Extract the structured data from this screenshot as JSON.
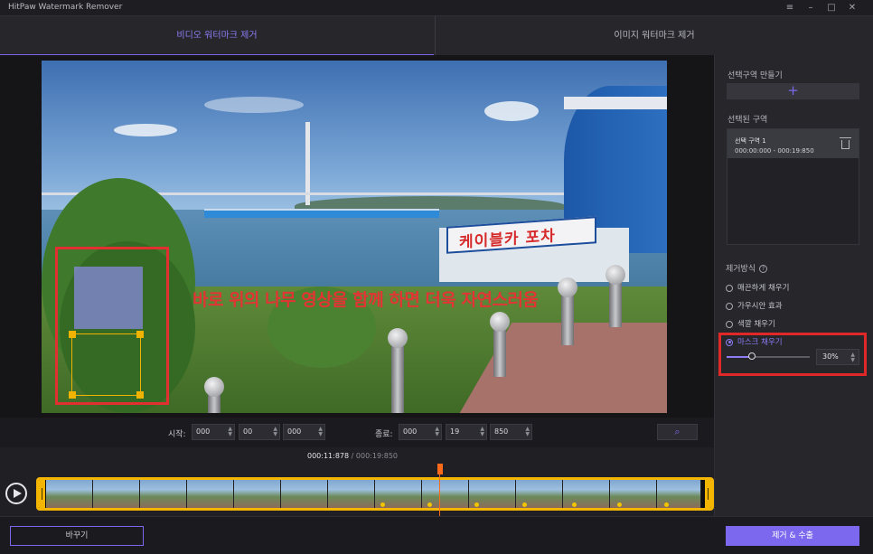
{
  "window": {
    "title": "HitPaw Watermark Remover",
    "controls": [
      "menu-icon",
      "minimize-icon",
      "maximize-icon",
      "close-icon"
    ]
  },
  "tabs": [
    {
      "label": "비디오 워터마크 제거",
      "active": true
    },
    {
      "label": "이미지 워터마크 제거",
      "active": false
    }
  ],
  "preview": {
    "overlay_text": "바로 위의 나무 영상을 함께 하면 더욱 자연스러움",
    "store_sign": "케이블카 포차"
  },
  "time_inputs": {
    "start_label": "시작:",
    "start": [
      "000",
      "00",
      "000"
    ],
    "end_label": "종료:",
    "end": [
      "000",
      "19",
      "850"
    ]
  },
  "timeline": {
    "current": "000:11:878",
    "separator": " / ",
    "total": "000:19:850",
    "progress": 0.598
  },
  "panel": {
    "create_region_label": "선택구역  만들기",
    "selected_regions_label": "선택된 구역",
    "regions": [
      {
        "name": "선택 구역 1",
        "range": "000:00:000 - 000:19:850"
      }
    ],
    "removal_method_label": "제거방식",
    "methods": [
      {
        "label": "매끈하게 채우기",
        "selected": false
      },
      {
        "label": "가우시안 효과",
        "selected": false
      },
      {
        "label": "색깔  채우기",
        "selected": false
      },
      {
        "label": "마스크 채우기",
        "selected": true
      }
    ],
    "opacity_value": "30%",
    "opacity_level": 0.3
  },
  "footer": {
    "replace_label": "바꾸기",
    "export_label": "제거 & 수출"
  },
  "colors": {
    "accent": "#7b68ee",
    "highlight": "#e02828",
    "timeline_frame": "#f3b500",
    "playhead": "#ff6a1a"
  }
}
